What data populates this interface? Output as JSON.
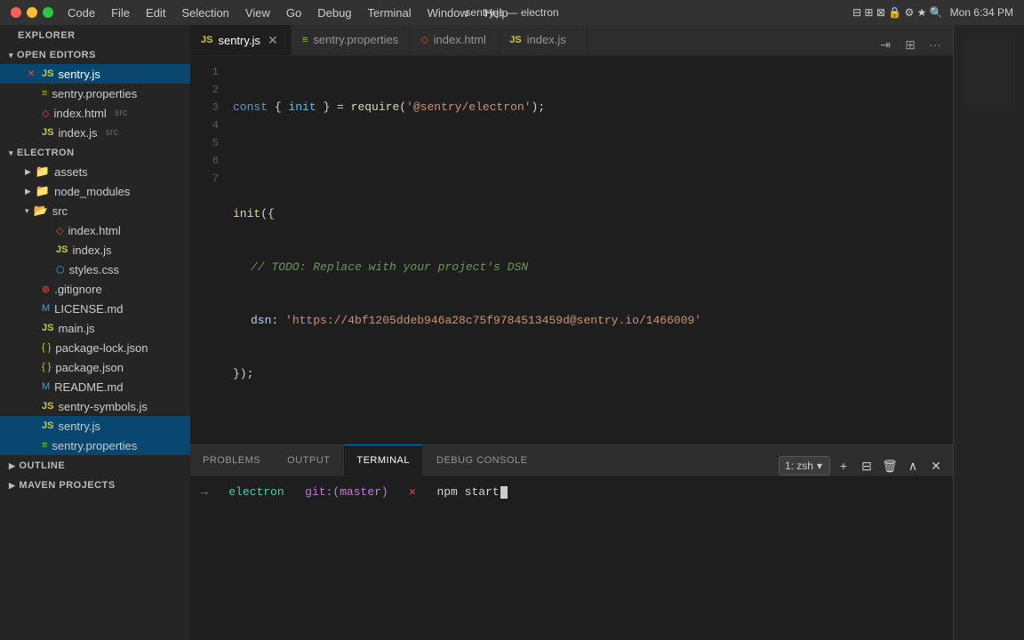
{
  "titlebar": {
    "title": "sentry.js — electron",
    "menu_items": [
      "Code",
      "File",
      "Edit",
      "Selection",
      "View",
      "Go",
      "Debug",
      "Terminal",
      "Window",
      "Help"
    ],
    "traffic": [
      "red",
      "yellow",
      "green"
    ],
    "right": "Mon 6:34 PM"
  },
  "sidebar": {
    "explorer_label": "EXPLORER",
    "sections": {
      "open_editors": {
        "label": "OPEN EDITORS",
        "items": [
          {
            "name": "sentry.js",
            "type": "js",
            "active": true,
            "close": true
          },
          {
            "name": "sentry.properties",
            "type": "prop"
          },
          {
            "name": "index.html",
            "type": "html",
            "src": true
          },
          {
            "name": "index.js",
            "type": "js",
            "src": true
          }
        ]
      },
      "electron": {
        "label": "ELECTRON",
        "subsections": [
          {
            "name": "assets",
            "type": "folder"
          },
          {
            "name": "node_modules",
            "type": "folder"
          },
          {
            "name": "src",
            "type": "folder",
            "open": true,
            "children": [
              {
                "name": "index.html",
                "type": "html"
              },
              {
                "name": "index.js",
                "type": "js"
              },
              {
                "name": "styles.css",
                "type": "css"
              }
            ]
          },
          {
            "name": ".gitignore",
            "type": "git"
          },
          {
            "name": "LICENSE.md",
            "type": "md"
          },
          {
            "name": "main.js",
            "type": "js"
          },
          {
            "name": "package-lock.json",
            "type": "json"
          },
          {
            "name": "package.json",
            "type": "json"
          },
          {
            "name": "README.md",
            "type": "md"
          },
          {
            "name": "sentry-symbols.js",
            "type": "js"
          },
          {
            "name": "sentry.js",
            "type": "js",
            "highlighted": true
          },
          {
            "name": "sentry.properties",
            "type": "prop"
          }
        ]
      },
      "outline": {
        "label": "OUTLINE"
      },
      "maven": {
        "label": "MAVEN PROJECTS"
      }
    }
  },
  "tabs": [
    {
      "name": "sentry.js",
      "type": "js",
      "active": true,
      "closeable": true
    },
    {
      "name": "sentry.properties",
      "type": "prop",
      "active": false
    },
    {
      "name": "index.html",
      "type": "html",
      "active": false
    },
    {
      "name": "index.js",
      "type": "js",
      "active": false
    }
  ],
  "code": {
    "lines": [
      {
        "num": "1",
        "content": "const { init } = require('@sentry/electron');"
      },
      {
        "num": "2",
        "content": ""
      },
      {
        "num": "3",
        "content": "init({"
      },
      {
        "num": "4",
        "content": "    // TODO: Replace with your project's DSN"
      },
      {
        "num": "5",
        "content": "    dsn: 'https://4bf1205ddeb946a28c75f9784513459d@sentry.io/1466009'"
      },
      {
        "num": "6",
        "content": "});"
      },
      {
        "num": "7",
        "content": ""
      }
    ]
  },
  "panel": {
    "tabs": [
      "PROBLEMS",
      "OUTPUT",
      "TERMINAL",
      "DEBUG CONSOLE"
    ],
    "active_tab": "TERMINAL",
    "terminal_label": "1: zsh",
    "terminal_prompt": "→",
    "terminal_dir": "electron",
    "terminal_git": "git:(master)",
    "terminal_x": "✕",
    "terminal_cmd": "npm start"
  }
}
